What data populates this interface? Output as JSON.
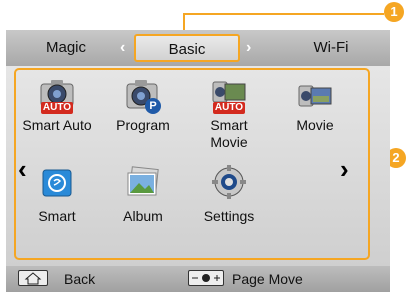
{
  "callouts": [
    "1",
    "2"
  ],
  "tabs": {
    "left": "Magic",
    "center": "Basic",
    "right": "Wi-Fi"
  },
  "modes": [
    {
      "label": "Smart Auto",
      "icon": "camera-auto-icon"
    },
    {
      "label": "Program",
      "icon": "camera-program-icon"
    },
    {
      "label": "Smart Movie",
      "icon": "movie-auto-icon"
    },
    {
      "label": "Movie",
      "icon": "movie-camera-icon"
    },
    {
      "label": "Smart",
      "icon": "smart-scene-icon"
    },
    {
      "label": "Album",
      "icon": "album-icon"
    },
    {
      "label": "Settings",
      "icon": "settings-gear-icon"
    }
  ],
  "auto_badge": "AUTO",
  "program_badge": "P",
  "bottom": {
    "back": "Back",
    "page_move": "Page Move"
  },
  "colors": {
    "accent": "#f5a623",
    "auto_red": "#d32a1e",
    "program_blue": "#1f5aa8"
  }
}
